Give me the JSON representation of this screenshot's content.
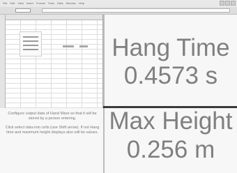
{
  "menubar": {
    "items": [
      "File",
      "Edit",
      "View",
      "Insert",
      "Format",
      "Tools",
      "Data",
      "Window",
      "Help"
    ]
  },
  "panel_top": {
    "title": "Hang Time",
    "value": "0.4573 s"
  },
  "panel_bottom": {
    "title": "Max Height",
    "value": "0.256 m"
  },
  "instructions": {
    "paragraph1": "Configure output data of Hand Ware so that it will be stored by a person entering.",
    "paragraph2": "Click select data into cells (use Shift arrow). If not Hang time and maximum height displays also will be values."
  }
}
